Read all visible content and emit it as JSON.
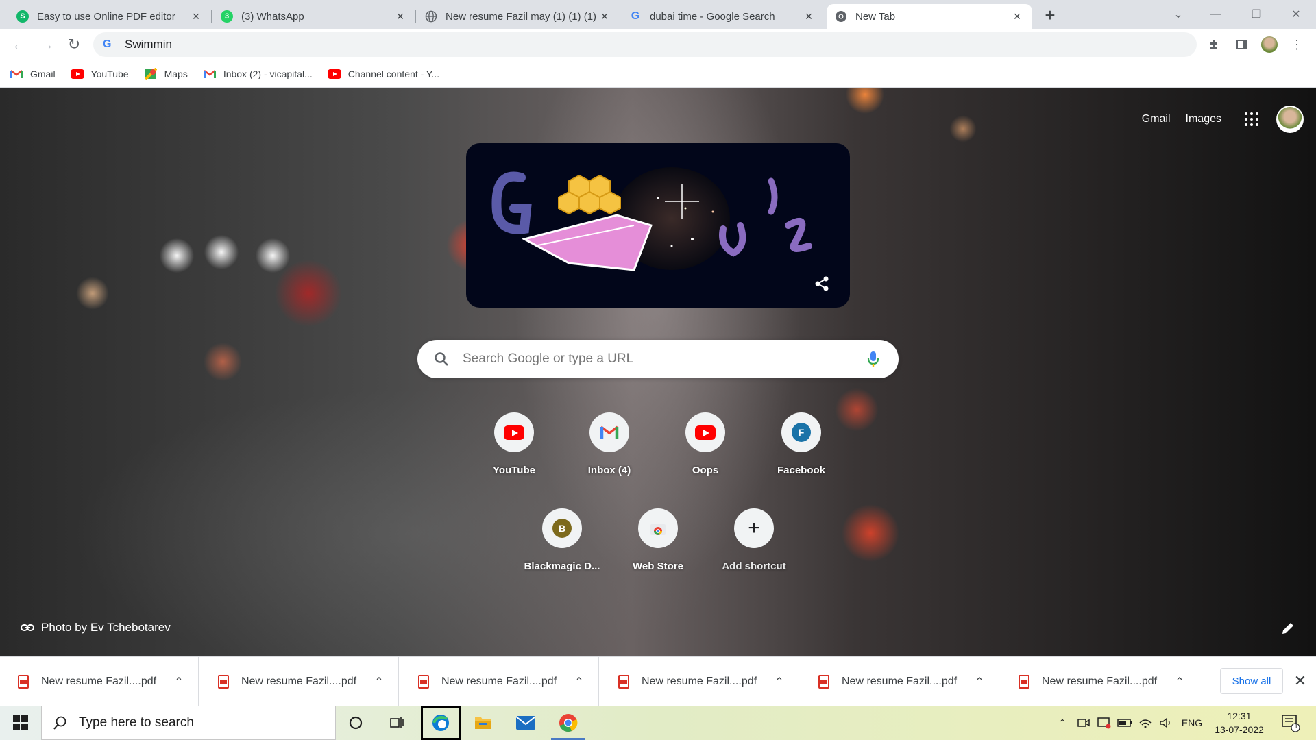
{
  "browser": {
    "tabs": [
      {
        "title": "Easy to use Online PDF editor",
        "favicon": "sejda-icon",
        "favicon_color": "#12b76a",
        "favicon_letter": "S"
      },
      {
        "title": "(3) WhatsApp",
        "favicon": "whatsapp-icon",
        "favicon_color": "#25d366",
        "favicon_letter": "3"
      },
      {
        "title": "New resume Fazil may (1) (1) (1)",
        "favicon": "globe-icon",
        "favicon_color": "#5f6368",
        "favicon_letter": ""
      },
      {
        "title": "dubai time - Google Search",
        "favicon": "google-icon",
        "favicon_color": "#4285f4",
        "favicon_letter": "G"
      },
      {
        "title": "New Tab",
        "favicon": "chrome-icon",
        "favicon_color": "#5f6368",
        "favicon_letter": ""
      }
    ],
    "active_tab_index": 4,
    "omnibox_text": "Swimmin",
    "bookmarks": [
      {
        "label": "Gmail",
        "icon": "gmail-icon"
      },
      {
        "label": "YouTube",
        "icon": "youtube-icon"
      },
      {
        "label": "Maps",
        "icon": "maps-icon"
      },
      {
        "label": "Inbox (2) - vicapital...",
        "icon": "gmail-icon"
      },
      {
        "label": "Channel content - Y...",
        "icon": "youtube-icon"
      }
    ]
  },
  "ntp": {
    "links": {
      "gmail": "Gmail",
      "images": "Images"
    },
    "search_placeholder": "Search Google or type a URL",
    "shortcuts": [
      {
        "label": "YouTube",
        "icon": "youtube-icon"
      },
      {
        "label": "Inbox (4)",
        "icon": "gmail-icon"
      },
      {
        "label": "Oops",
        "icon": "youtube-icon"
      },
      {
        "label": "Facebook",
        "icon": "letter-icon",
        "letter": "F",
        "color": "#1a73a8"
      },
      {
        "label": "Blackmagic D...",
        "icon": "letter-icon",
        "letter": "B",
        "color": "#7d6a1d"
      },
      {
        "label": "Web Store",
        "icon": "chrome-web-store-icon"
      },
      {
        "label": "Add shortcut",
        "icon": "plus-icon"
      }
    ],
    "photo_credit": "Photo by Ev Tchebotarev"
  },
  "downloads": {
    "items": [
      "New resume Fazil....pdf",
      "New resume Fazil....pdf",
      "New resume Fazil....pdf",
      "New resume Fazil....pdf",
      "New resume Fazil....pdf",
      "New resume Fazil....pdf"
    ],
    "show_all": "Show all"
  },
  "taskbar": {
    "search_placeholder": "Type here to search",
    "language": "ENG",
    "time": "12:31",
    "date": "13-07-2022",
    "notification_count": "1"
  }
}
